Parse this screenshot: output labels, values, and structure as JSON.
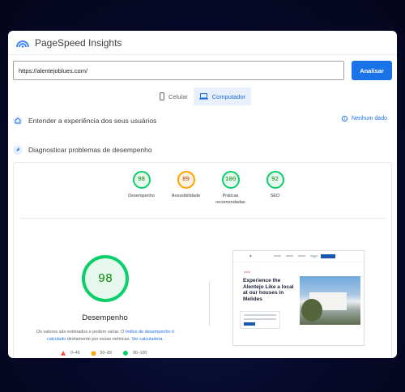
{
  "app": {
    "title": "PageSpeed Insights"
  },
  "search": {
    "url": "https://alentejoblues.com/",
    "button_label": "Analisar"
  },
  "tabs": [
    {
      "label": "Celular",
      "icon": "phone-icon",
      "active": false
    },
    {
      "label": "Computador",
      "icon": "laptop-icon",
      "active": true
    }
  ],
  "sections": {
    "experience": {
      "title": "Entender a experiência dos seus usuários",
      "no_data": "Nenhum dado"
    },
    "diagnose": {
      "title": "Diagnosticar problemas de desempenho"
    }
  },
  "scores": [
    {
      "value": "98",
      "label": "Desempenho",
      "status": "good"
    },
    {
      "value": "89",
      "label": "Acessibilidade",
      "status": "average"
    },
    {
      "value": "100",
      "label": "Práticas recomendadas",
      "status": "good"
    },
    {
      "value": "92",
      "label": "SEO",
      "status": "good"
    }
  ],
  "performance": {
    "value": "98",
    "title": "Desempenho",
    "note_prefix": "Os valores são estimados e podem variar. O",
    "note_link": "índice de desempenho é calculado",
    "note_middle": "diretamente por essas métricas.",
    "note_link2": "Ver calculadora."
  },
  "legend": [
    {
      "range": "0–49",
      "shape": "triangle",
      "color": "#ff4e42"
    },
    {
      "range": "50–89",
      "shape": "square",
      "color": "#ffa400"
    },
    {
      "range": "90–100",
      "shape": "circle",
      "color": "#0cce6b"
    }
  ],
  "preview": {
    "headline": "Experience the Alentejo Like a local at our houses in Melides"
  },
  "colors": {
    "accent": "#1a73e8",
    "good": "#0cce6b",
    "average": "#ffa400",
    "poor": "#ff4e42"
  }
}
